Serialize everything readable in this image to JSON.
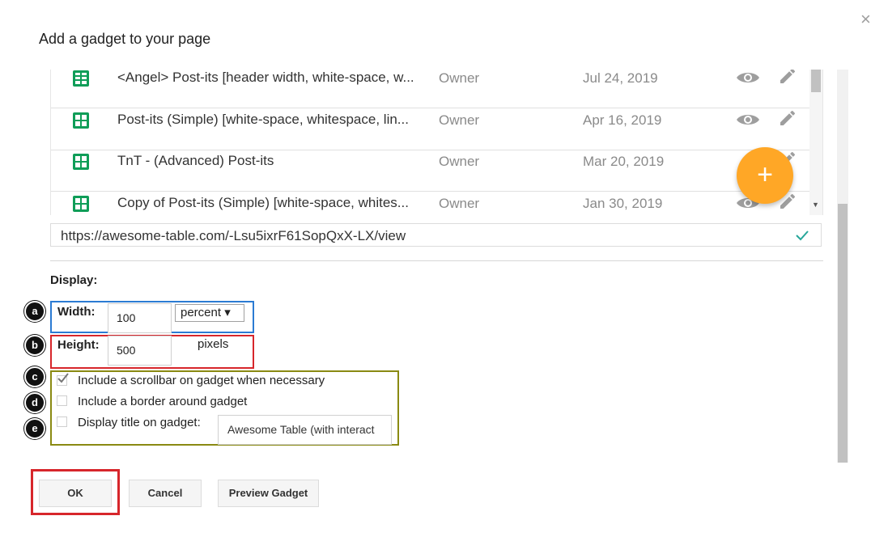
{
  "dialog": {
    "title": "Add a gadget to your page",
    "close_glyph": "×"
  },
  "files": [
    {
      "name": "<Angel> Post-its [header width, white-space, w...",
      "owner": "Owner",
      "date": "Jul 24, 2019",
      "icon": "sheets-icon"
    },
    {
      "name": "Post-its (Simple) [white-space, whitespace, lin...",
      "owner": "Owner",
      "date": "Apr 16, 2019",
      "icon": "sheets-icon"
    },
    {
      "name": "TnT - (Advanced) Post-its",
      "owner": "Owner",
      "date": "Mar 20, 2019",
      "icon": "sheets-icon"
    },
    {
      "name": "Copy of Post-its (Simple) [white-space, whites...",
      "owner": "Owner",
      "date": "Jan 30, 2019",
      "icon": "sheets-icon"
    }
  ],
  "fab": {
    "glyph": "+",
    "color": "#ffa726"
  },
  "url": {
    "value": "https://awesome-table.com/-Lsu5ixrF61SopQxX-LX/view"
  },
  "display": {
    "label": "Display:",
    "width": {
      "label": "Width:",
      "value": "100",
      "unit": "percent ▾"
    },
    "height": {
      "label": "Height:",
      "value": "500",
      "unit": "pixels"
    },
    "scrollbar": {
      "label": "Include a scrollbar on gadget when necessary",
      "checked": true
    },
    "border": {
      "label": "Include a border around gadget",
      "checked": false
    },
    "show_title": {
      "label": "Display title on gadget:",
      "checked": false,
      "value": "Awesome Table (with interact"
    }
  },
  "callouts": [
    "a",
    "b",
    "c",
    "d",
    "e"
  ],
  "buttons": {
    "ok": "OK",
    "cancel": "Cancel",
    "preview": "Preview Gadget"
  },
  "colors": {
    "sheets_green": "#0f9d58",
    "check_teal": "#26a69a",
    "highlight_blue": "#2b7bd3",
    "highlight_red": "#d7262b",
    "highlight_olive": "#8a8a12"
  }
}
